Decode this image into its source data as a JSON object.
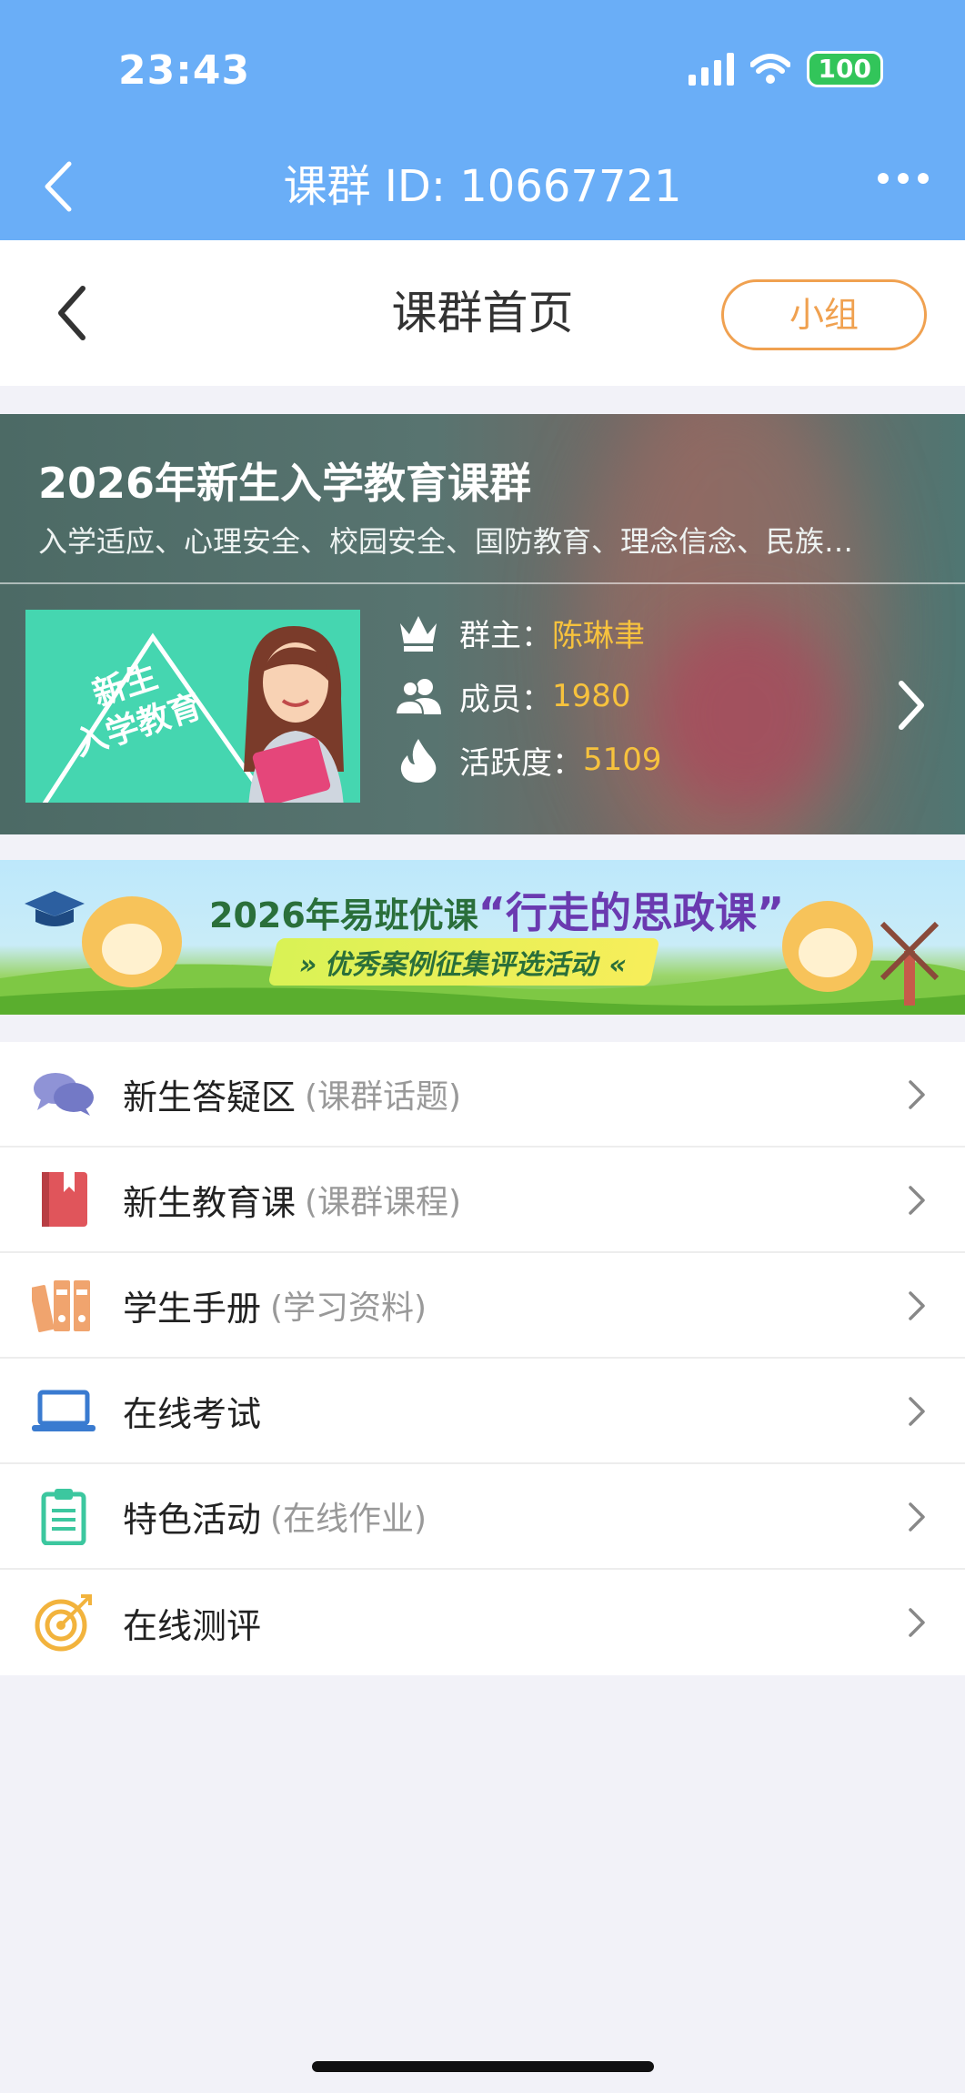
{
  "status_bar": {
    "time": "23:43",
    "battery": "100"
  },
  "nav": {
    "title": "课群 ID: 10667721"
  },
  "subheader": {
    "title": "课群首页",
    "group_button": "小组"
  },
  "card": {
    "title": "2026年新生入学教育课群",
    "description": "入学适应、心理安全、校园安全、国防教育、理念信念、民族…",
    "cover_text_line1": "新生",
    "cover_text_line2": "入学教育",
    "owner_label": "群主：",
    "owner_value": "陈琳聿",
    "members_label": "成员：",
    "members_value": "1980",
    "activity_label": "活跃度：",
    "activity_value": "5109"
  },
  "banner": {
    "title_prefix": "2026年易班优课",
    "title_main": "“行走的思政课”",
    "subtitle": "» 优秀案例征集评选活动 «"
  },
  "menu": [
    {
      "label": "新生答疑区",
      "sub": "(课群话题)",
      "icon": "chat-bubbles-icon"
    },
    {
      "label": "新生教育课",
      "sub": "(课群课程)",
      "icon": "book-icon"
    },
    {
      "label": "学生手册",
      "sub": "(学习资料)",
      "icon": "binders-icon"
    },
    {
      "label": "在线考试",
      "sub": "",
      "icon": "laptop-icon"
    },
    {
      "label": "特色活动",
      "sub": "(在线作业)",
      "icon": "clipboard-icon"
    },
    {
      "label": "在线测评",
      "sub": "",
      "icon": "target-icon"
    }
  ],
  "colors": {
    "topbar": "#6aaef7",
    "accent_orange": "#f0a150",
    "value_yellow": "#f7c23d"
  }
}
